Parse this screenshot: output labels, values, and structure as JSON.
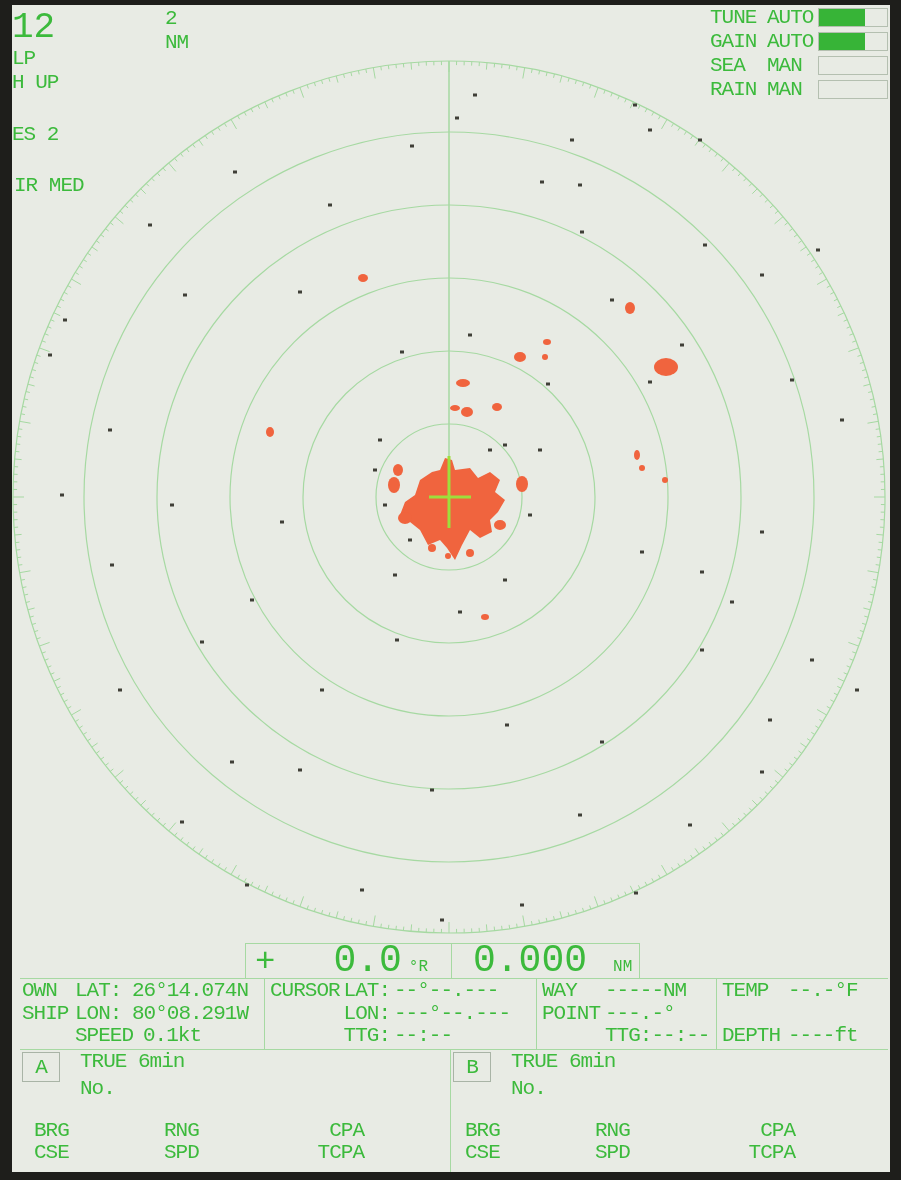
{
  "status": {
    "range": "12",
    "pulse": "LP",
    "orientation": "H UP",
    "echo_stretch": "ES 2",
    "interference_rejection": "IR MED",
    "ring_interval": {
      "value": "2",
      "unit": "NM"
    }
  },
  "controls": [
    {
      "name": "TUNE",
      "mode": "AUTO",
      "level": 0.68
    },
    {
      "name": "GAIN",
      "mode": "AUTO",
      "level": 0.68
    },
    {
      "name": "SEA",
      "mode": "MAN",
      "level": 0
    },
    {
      "name": "RAIN",
      "mode": "MAN",
      "level": 0
    }
  ],
  "cursor_readout": {
    "symbol": "+",
    "bearing": "0.0",
    "bearing_unit": "°R",
    "range": "0.000",
    "range_unit": "NM"
  },
  "info_panels": [
    {
      "rows": [
        {
          "label": "OWN",
          "field": "LAT:",
          "value": "26°14.074N"
        },
        {
          "label": "SHIP",
          "field": "LON:",
          "value": "80°08.291W"
        },
        {
          "field": "SPEED",
          "value": "0.1kt"
        }
      ]
    },
    {
      "rows": [
        {
          "label": "CURSOR",
          "field": "LAT:",
          "value": "--°--.---"
        },
        {
          "field": "LON:",
          "value": "---°--.---"
        },
        {
          "field": "TTG:",
          "value": "--:--"
        }
      ]
    },
    {
      "rows": [
        {
          "label": "WAY",
          "value": "-----NM"
        },
        {
          "label": "POINT",
          "value": "---.-°"
        },
        {
          "field": "TTG:",
          "value": "--:--"
        }
      ]
    },
    {
      "rows": [
        {
          "label": "TEMP",
          "value": "--.-°F"
        },
        {
          "label": "DEPTH",
          "value": "----ft"
        }
      ]
    }
  ],
  "targets": [
    {
      "letter": "A",
      "vector": "TRUE 6min",
      "number": "No.",
      "fields": [
        {
          "top": "BRG",
          "bottom": "CSE"
        },
        {
          "top": "RNG",
          "bottom": "SPD"
        },
        {
          "top": "CPA",
          "bottom": "TCPA"
        }
      ]
    },
    {
      "letter": "B",
      "vector": "TRUE 6min",
      "number": "No.",
      "fields": [
        {
          "top": "BRG",
          "bottom": "CSE"
        },
        {
          "top": "RNG",
          "bottom": "SPD"
        },
        {
          "top": "CPA",
          "bottom": "TCPA"
        }
      ]
    }
  ]
}
